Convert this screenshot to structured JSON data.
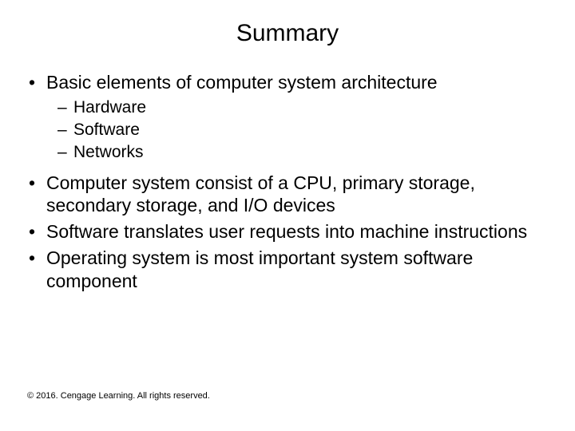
{
  "title": "Summary",
  "bullets": {
    "b1": "Basic elements of computer system architecture",
    "b1sub": {
      "s1": "Hardware",
      "s2": "Software",
      "s3": "Networks"
    },
    "b2": "Computer system consist of a CPU, primary storage, secondary storage, and I/O devices",
    "b3": "Software translates user requests into machine instructions",
    "b4": "Operating system is most important system software component"
  },
  "footer": "© 2016. Cengage Learning. All rights reserved."
}
